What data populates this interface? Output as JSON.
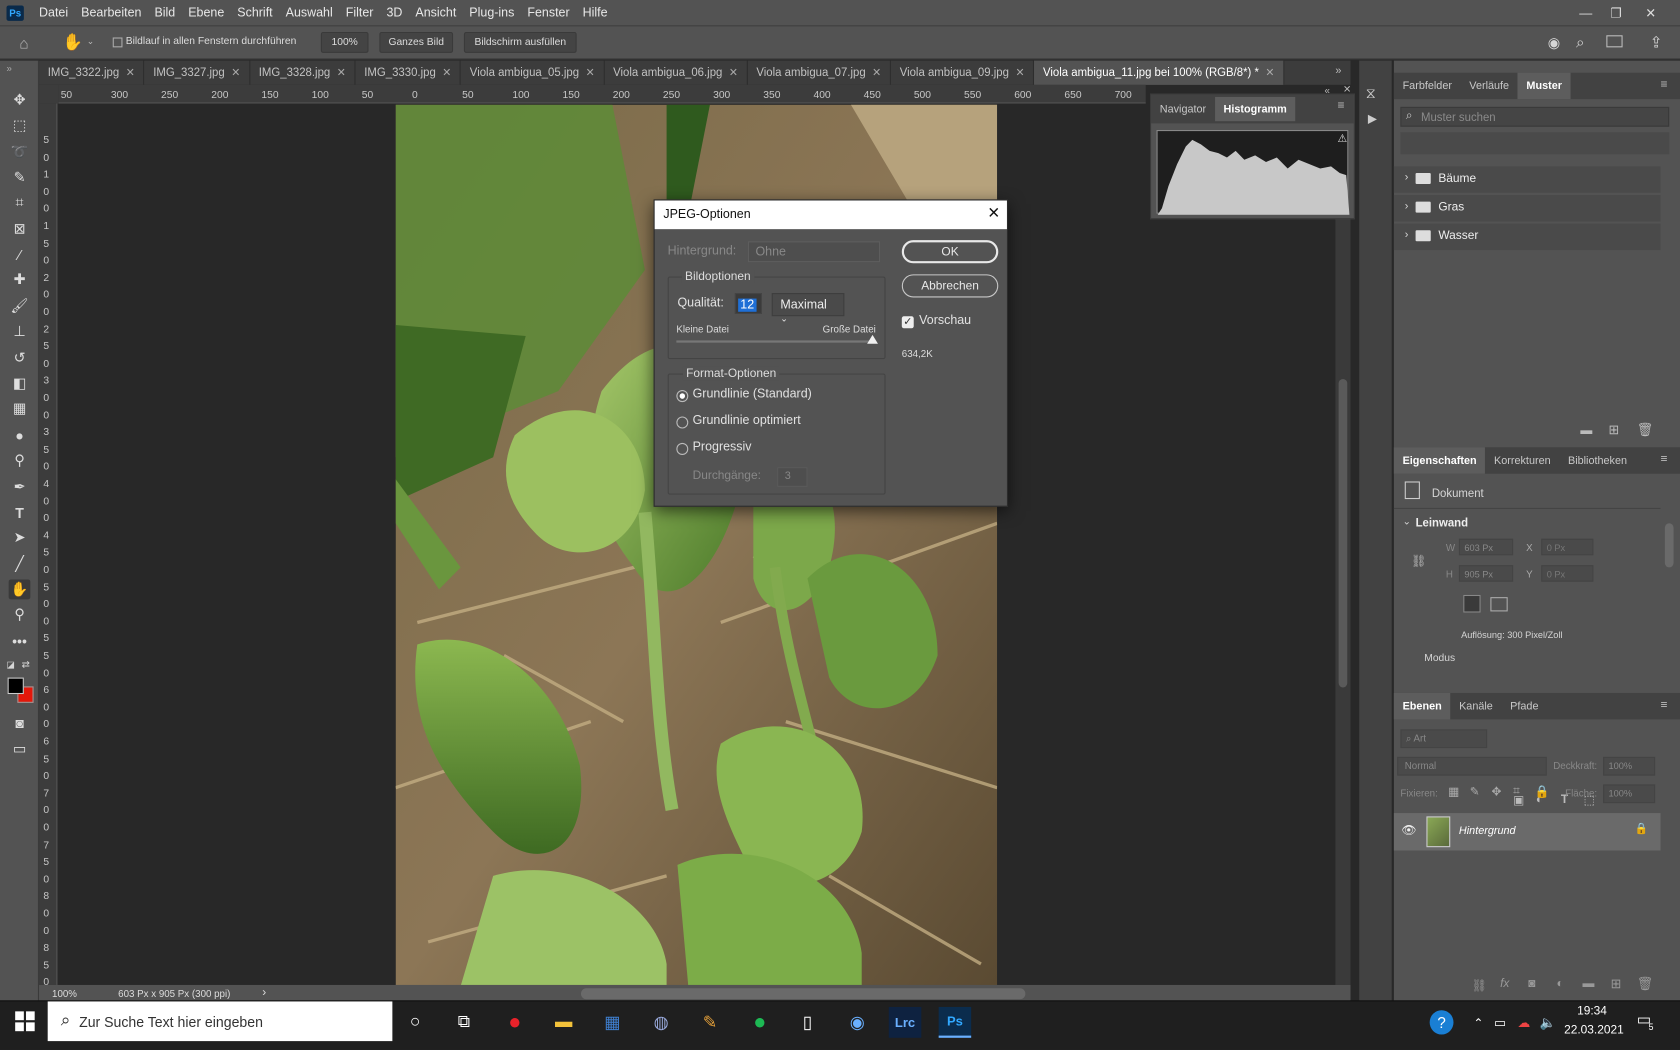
{
  "menu": {
    "logo": "Ps",
    "items": [
      "Datei",
      "Bearbeiten",
      "Bild",
      "Ebene",
      "Schrift",
      "Auswahl",
      "Filter",
      "3D",
      "Ansicht",
      "Plug-ins",
      "Fenster",
      "Hilfe"
    ]
  },
  "options": {
    "scroll_all": "Bildlauf in allen Fenstern durchführen",
    "zoom": "100%",
    "fit": "Ganzes Bild",
    "fill": "Bildschirm ausfüllen"
  },
  "tabs": [
    "IMG_3322.jpg",
    "IMG_3327.jpg",
    "IMG_3328.jpg",
    "IMG_3330.jpg",
    "Viola ambigua_05.jpg",
    "Viola ambigua_06.jpg",
    "Viola ambigua_07.jpg",
    "Viola ambigua_09.jpg",
    "Viola ambigua_11.jpg bei 100% (RGB/8*) *"
  ],
  "ruler_h": [
    "50",
    "300",
    "250",
    "200",
    "150",
    "100",
    "50",
    "0",
    "50",
    "100",
    "150",
    "200",
    "250",
    "300",
    "350",
    "400",
    "450",
    "500",
    "550",
    "600",
    "650",
    "700"
  ],
  "ruler_v": [
    "5",
    "0",
    "1",
    "0",
    "0",
    "1",
    "5",
    "0",
    "2",
    "0",
    "0",
    "2",
    "5",
    "0",
    "3",
    "0",
    "0",
    "3",
    "5",
    "0",
    "4",
    "0",
    "0",
    "4",
    "5",
    "0",
    "5",
    "0",
    "0",
    "5",
    "5",
    "0",
    "6",
    "0",
    "0",
    "6",
    "5",
    "0",
    "7",
    "0",
    "0",
    "7",
    "5",
    "0",
    "8",
    "0",
    "0",
    "8",
    "5",
    "0"
  ],
  "status": {
    "zoom": "100%",
    "size": "603 Px x 905 Px (300 ppi)"
  },
  "histo": {
    "tab1": "Navigator",
    "tab2": "Histogramm"
  },
  "muster": {
    "tab1": "Farbfelder",
    "tab2": "Verläufe",
    "tab3": "Muster",
    "search_placeholder": "Muster suchen",
    "folders": [
      "Bäume",
      "Gras",
      "Wasser"
    ]
  },
  "props": {
    "tab1": "Eigenschaften",
    "tab2": "Korrekturen",
    "tab3": "Bibliotheken",
    "doc": "Dokument",
    "section": "Leinwand",
    "w_label": "W",
    "w": "603 Px",
    "h_label": "H",
    "h": "905 Px",
    "x_label": "X",
    "x": "0 Px",
    "y_label": "Y",
    "y": "0 Px",
    "resolution": "Auflösung: 300 Pixel/Zoll",
    "mode": "Modus"
  },
  "layers": {
    "tab1": "Ebenen",
    "tab2": "Kanäle",
    "tab3": "Pfade",
    "filter": "Art",
    "blend": "Normal",
    "opacity_label": "Deckkraft:",
    "opacity": "100%",
    "lock_label": "Fixieren:",
    "fill_label": "Fläche:",
    "fill": "100%",
    "layer_name": "Hintergrund"
  },
  "dialog": {
    "title": "JPEG-Optionen",
    "bg_label": "Hintergrund:",
    "bg_value": "Ohne",
    "group1": "Bildoptionen",
    "quality_label": "Qualität:",
    "quality": "12",
    "quality_preset": "Maximal",
    "small": "Kleine Datei",
    "large": "Große Datei",
    "group2": "Format-Optionen",
    "opt1": "Grundlinie (Standard)",
    "opt2": "Grundlinie optimiert",
    "opt3": "Progressiv",
    "passes_label": "Durchgänge:",
    "passes": "3",
    "ok": "OK",
    "cancel": "Abbrechen",
    "preview": "Vorschau",
    "filesize": "634,2K",
    "quality_level": 1.0
  },
  "taskbar": {
    "search": "Zur Suche Text hier eingeben",
    "time": "19:34",
    "date": "22.03.2021",
    "notif": "5",
    "lrc": "Lrc",
    "ps": "Ps"
  }
}
